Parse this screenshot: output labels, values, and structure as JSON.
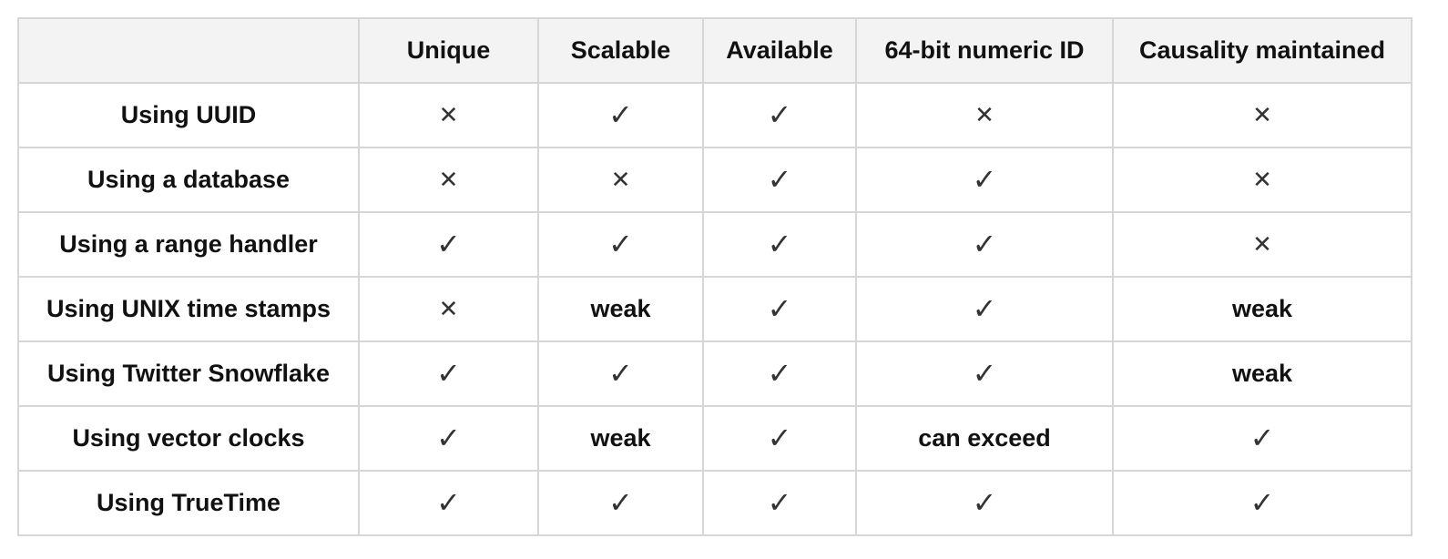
{
  "table": {
    "headers": [
      "",
      "Unique",
      "Scalable",
      "Available",
      "64-bit numeric ID",
      "Causality maintained"
    ],
    "rows": [
      {
        "label": "Using UUID",
        "cells": [
          "cross",
          "check",
          "check",
          "cross",
          "cross"
        ]
      },
      {
        "label": "Using a database",
        "cells": [
          "cross",
          "cross",
          "check",
          "check",
          "cross"
        ]
      },
      {
        "label": "Using a range handler",
        "cells": [
          "check",
          "check",
          "check",
          "check",
          "cross"
        ]
      },
      {
        "label": "Using UNIX time stamps",
        "cells": [
          "cross",
          "weak",
          "check",
          "check",
          "weak"
        ]
      },
      {
        "label": "Using Twitter Snowflake",
        "cells": [
          "check",
          "check",
          "check",
          "check",
          "weak"
        ]
      },
      {
        "label": "Using vector clocks",
        "cells": [
          "check",
          "weak",
          "check",
          "can exceed",
          "check"
        ]
      },
      {
        "label": "Using TrueTime",
        "cells": [
          "check",
          "check",
          "check",
          "check",
          "check"
        ]
      }
    ]
  },
  "symbols": {
    "check": "✓",
    "cross": "✕"
  },
  "colors": {
    "header_bg": "#f3f3f3",
    "border": "#d6d6d6",
    "mark": "#333333"
  }
}
